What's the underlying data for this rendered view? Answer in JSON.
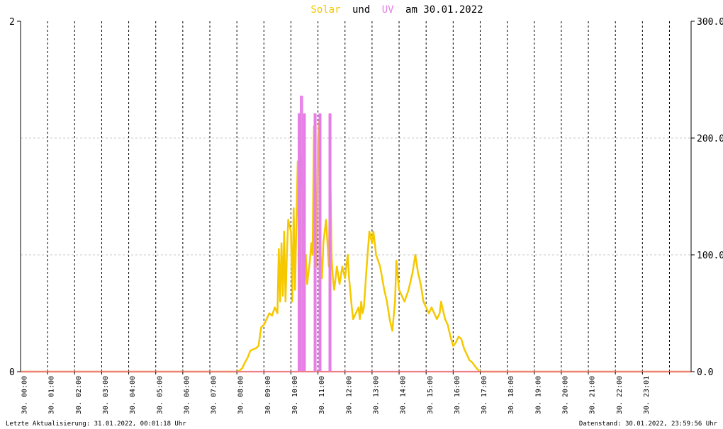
{
  "title": {
    "solar_word": "Solar",
    "and_word": "und",
    "uv_word": "UV",
    "date_text": "am 30.01.2022"
  },
  "footer": {
    "left": "Letzte Aktualisierung: 31.01.2022, 00:01:18 Uhr",
    "right": "Datenstand: 30.01.2022, 23:59:56 Uhr"
  },
  "colors": {
    "solar": "#f5c800",
    "uv": "#e57fe5",
    "baseline": "#f08080",
    "axis": "#000000",
    "grid": "#c8c8c8"
  },
  "chart_data": {
    "type": "line",
    "title": "Solar und UV am 30.01.2022",
    "x_ticks": [
      "30. 00:00",
      "30. 01:00",
      "30. 02:00",
      "30. 03:00",
      "30. 04:00",
      "30. 05:00",
      "30. 06:00",
      "30. 07:00",
      "30. 08:00",
      "30. 09:00",
      "30. 10:00",
      "30. 11:00",
      "30. 12:00",
      "30. 13:00",
      "30. 14:00",
      "30. 15:00",
      "30. 16:00",
      "30. 17:00",
      "30. 18:00",
      "30. 19:00",
      "30. 20:00",
      "30. 21:00",
      "30. 22:00",
      "30. 23:01"
    ],
    "x_range_hours": [
      0,
      24.8
    ],
    "y_left": {
      "range": [
        0,
        2
      ],
      "ticks": [
        "0",
        "2"
      ]
    },
    "y_right": {
      "range": [
        0,
        300
      ],
      "ticks": [
        "0.0",
        "100.0",
        "200.0",
        "300.0"
      ]
    },
    "grid": true,
    "series": [
      {
        "name": "Solar",
        "axis": "right",
        "points": [
          [
            0,
            0
          ],
          [
            8.0,
            0
          ],
          [
            8.1,
            1
          ],
          [
            8.2,
            3
          ],
          [
            8.3,
            8
          ],
          [
            8.4,
            12
          ],
          [
            8.5,
            18
          ],
          [
            8.6,
            19
          ],
          [
            8.7,
            20
          ],
          [
            8.8,
            22
          ],
          [
            8.9,
            38
          ],
          [
            9.0,
            40
          ],
          [
            9.1,
            45
          ],
          [
            9.2,
            50
          ],
          [
            9.3,
            48
          ],
          [
            9.4,
            55
          ],
          [
            9.5,
            50
          ],
          [
            9.55,
            105
          ],
          [
            9.6,
            60
          ],
          [
            9.65,
            110
          ],
          [
            9.7,
            65
          ],
          [
            9.75,
            120
          ],
          [
            9.8,
            60
          ],
          [
            9.85,
            100
          ],
          [
            9.9,
            130
          ],
          [
            10.0,
            120
          ],
          [
            10.05,
            60
          ],
          [
            10.1,
            140
          ],
          [
            10.15,
            70
          ],
          [
            10.25,
            180
          ],
          [
            10.3,
            90
          ],
          [
            10.35,
            170
          ],
          [
            10.4,
            185
          ],
          [
            10.45,
            110
          ],
          [
            10.5,
            90
          ],
          [
            10.55,
            100
          ],
          [
            10.6,
            75
          ],
          [
            10.7,
            95
          ],
          [
            10.75,
            110
          ],
          [
            10.8,
            100
          ],
          [
            10.85,
            210
          ],
          [
            10.9,
            120
          ],
          [
            10.95,
            90
          ],
          [
            11.0,
            200
          ],
          [
            11.05,
            215
          ],
          [
            11.1,
            100
          ],
          [
            11.15,
            80
          ],
          [
            11.2,
            110
          ],
          [
            11.3,
            130
          ],
          [
            11.4,
            90
          ],
          [
            11.45,
            180
          ],
          [
            11.5,
            100
          ],
          [
            11.55,
            80
          ],
          [
            11.6,
            70
          ],
          [
            11.7,
            90
          ],
          [
            11.8,
            75
          ],
          [
            11.9,
            90
          ],
          [
            12.0,
            80
          ],
          [
            12.1,
            100
          ],
          [
            12.15,
            80
          ],
          [
            12.25,
            55
          ],
          [
            12.3,
            45
          ],
          [
            12.4,
            50
          ],
          [
            12.5,
            55
          ],
          [
            12.55,
            45
          ],
          [
            12.6,
            60
          ],
          [
            12.65,
            50
          ],
          [
            12.7,
            55
          ],
          [
            12.8,
            90
          ],
          [
            12.9,
            120
          ],
          [
            13.0,
            110
          ],
          [
            13.05,
            120
          ],
          [
            13.15,
            100
          ],
          [
            13.3,
            90
          ],
          [
            13.45,
            70
          ],
          [
            13.55,
            60
          ],
          [
            13.65,
            45
          ],
          [
            13.75,
            35
          ],
          [
            13.85,
            60
          ],
          [
            13.9,
            95
          ],
          [
            14.0,
            70
          ],
          [
            14.1,
            65
          ],
          [
            14.2,
            60
          ],
          [
            14.35,
            70
          ],
          [
            14.5,
            85
          ],
          [
            14.6,
            100
          ],
          [
            14.7,
            85
          ],
          [
            14.8,
            75
          ],
          [
            14.9,
            60
          ],
          [
            15.0,
            55
          ],
          [
            15.1,
            50
          ],
          [
            15.2,
            55
          ],
          [
            15.3,
            50
          ],
          [
            15.4,
            45
          ],
          [
            15.5,
            50
          ],
          [
            15.55,
            60
          ],
          [
            15.6,
            55
          ],
          [
            15.7,
            45
          ],
          [
            15.8,
            40
          ],
          [
            15.9,
            30
          ],
          [
            16.0,
            22
          ],
          [
            16.1,
            25
          ],
          [
            16.2,
            30
          ],
          [
            16.3,
            28
          ],
          [
            16.4,
            20
          ],
          [
            16.5,
            15
          ],
          [
            16.6,
            10
          ],
          [
            16.7,
            8
          ],
          [
            16.8,
            5
          ],
          [
            16.9,
            2
          ],
          [
            17.0,
            0
          ],
          [
            24.8,
            0
          ]
        ]
      },
      {
        "name": "UV",
        "axis": "left",
        "points": [
          [
            0,
            0
          ],
          [
            10.28,
            0
          ],
          [
            10.28,
            1.47
          ],
          [
            10.33,
            1.47
          ],
          [
            10.33,
            0
          ],
          [
            10.36,
            0
          ],
          [
            10.36,
            1.57
          ],
          [
            10.42,
            1.57
          ],
          [
            10.42,
            0
          ],
          [
            10.48,
            0
          ],
          [
            10.48,
            1.47
          ],
          [
            10.52,
            1.47
          ],
          [
            10.52,
            0
          ],
          [
            10.87,
            0
          ],
          [
            10.87,
            1.47
          ],
          [
            10.92,
            1.47
          ],
          [
            10.92,
            0
          ],
          [
            11.05,
            0
          ],
          [
            11.05,
            1.47
          ],
          [
            11.1,
            1.47
          ],
          [
            11.1,
            0
          ],
          [
            11.42,
            0
          ],
          [
            11.42,
            1.47
          ],
          [
            11.47,
            1.47
          ],
          [
            11.47,
            0
          ],
          [
            24.8,
            0
          ]
        ]
      }
    ]
  }
}
